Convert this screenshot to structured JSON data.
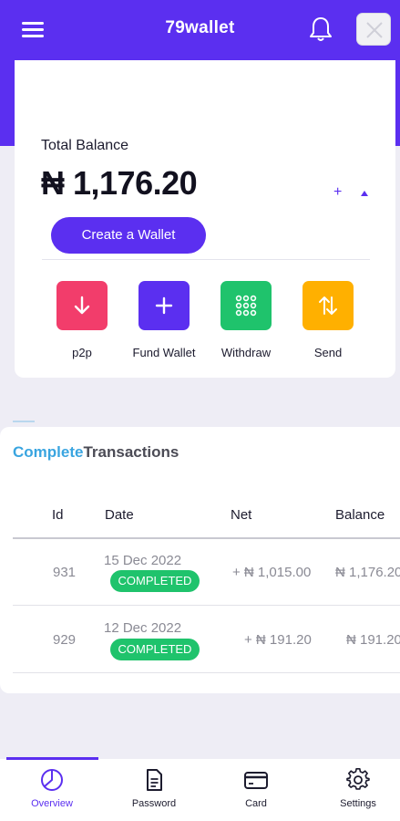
{
  "header": {
    "title": "79wallet",
    "menu_icon": "menu-icon",
    "notification_icon": "bell-icon",
    "avatar_icon": "avatar-placeholder-icon",
    "brand_color": "#5b2ff0"
  },
  "balance": {
    "label": "Total Balance",
    "amount": "₦ 1,176.20",
    "plus": "+",
    "create_wallet_label": "Create a Wallet"
  },
  "actions": [
    {
      "label": "p2p",
      "icon": "arrow-down-icon",
      "color": "#f23d6b"
    },
    {
      "label": "Fund Wallet",
      "icon": "plus-icon",
      "color": "#5b2ff0"
    },
    {
      "label": "Withdraw",
      "icon": "grid-dots-icon",
      "color": "#1fc36c"
    },
    {
      "label": "Send",
      "icon": "swap-arrows-icon",
      "color": "#ffb000"
    }
  ],
  "transactions": {
    "title_part1": "Complete",
    "title_part2": "Transactions",
    "columns": [
      "Id",
      "Date",
      "Net",
      "Balance"
    ],
    "rows": [
      {
        "id": "931",
        "date": "15 Dec 2022",
        "status": "COMPLETED",
        "net": "+ ₦ 1,015.00",
        "balance": "₦ 1,176.20"
      },
      {
        "id": "929",
        "date": "12 Dec 2022",
        "status": "COMPLETED",
        "net": "+ ₦ 191.20",
        "balance": "₦ 191.20"
      }
    ],
    "status_color": "#1fc36c"
  },
  "bottom_nav": [
    {
      "label": "Overview",
      "icon": "pie-chart-icon",
      "active": true
    },
    {
      "label": "Password",
      "icon": "document-icon",
      "active": false
    },
    {
      "label": "Card",
      "icon": "credit-card-icon",
      "active": false
    },
    {
      "label": "Settings",
      "icon": "gear-icon",
      "active": false
    }
  ]
}
